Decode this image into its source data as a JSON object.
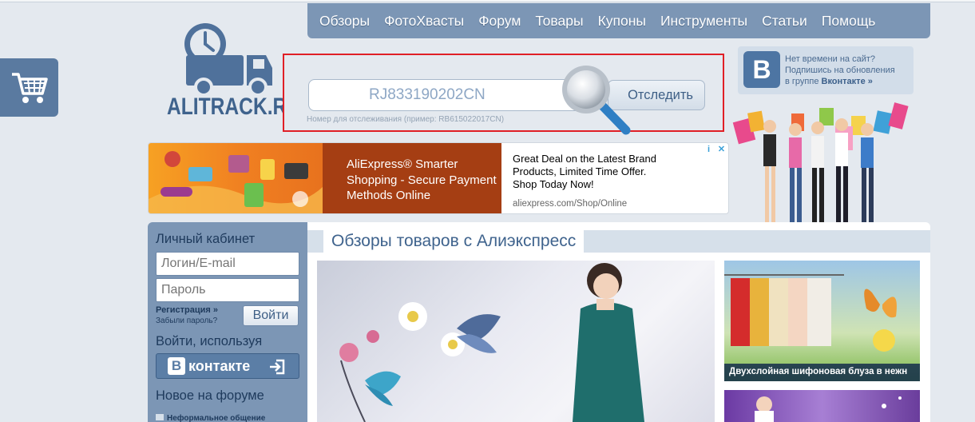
{
  "nav": {
    "items": [
      "Обзоры",
      "ФотоХвасты",
      "Форум",
      "Товары",
      "Купоны",
      "Инструменты",
      "Статьи",
      "Помощь"
    ]
  },
  "logo": {
    "text": "ALITRACK.RU"
  },
  "tracking": {
    "input_value": "RJ833190202CN",
    "hint": "Номер для отслеживания (пример: RB615022017CN)",
    "button_label": "Отследить"
  },
  "vk_promo": {
    "logo_letter": "B",
    "line1": "Нет времени на сайт?",
    "line2": "Подпишись на обновления",
    "line3_prefix": "в группе ",
    "line3_link": "Вконтакте »"
  },
  "ad": {
    "mid_text": "AliExpress® Smarter Shopping - Secure Payment Methods Online",
    "right_text": "Great Deal on the Latest Brand Products, Limited Time Offer. Shop Today Now!",
    "url": "aliexpress.com/Shop/Online",
    "info_icon": "i",
    "close_icon": "✕"
  },
  "cabinet": {
    "title": "Личный кабинет",
    "login_placeholder": "Логин/E-mail",
    "password_placeholder": "Пароль",
    "register": "Регистрация »",
    "forgot": "Забыли пароль?",
    "login_button": "Войти",
    "via_title": "Войти, используя",
    "vk_button_letter": "B",
    "vk_button_label": "контакте"
  },
  "forum": {
    "title": "Новое на форуме",
    "first_item": "Неформальное общение"
  },
  "main": {
    "title": "Обзоры товаров с Алиэкспресс",
    "thumb1_caption": "Двухслойная шифоновая блуза в нежн"
  },
  "colors": {
    "nav_bg": "#7c96b5",
    "accent": "#3f638d",
    "search_frame": "#e01f26"
  }
}
